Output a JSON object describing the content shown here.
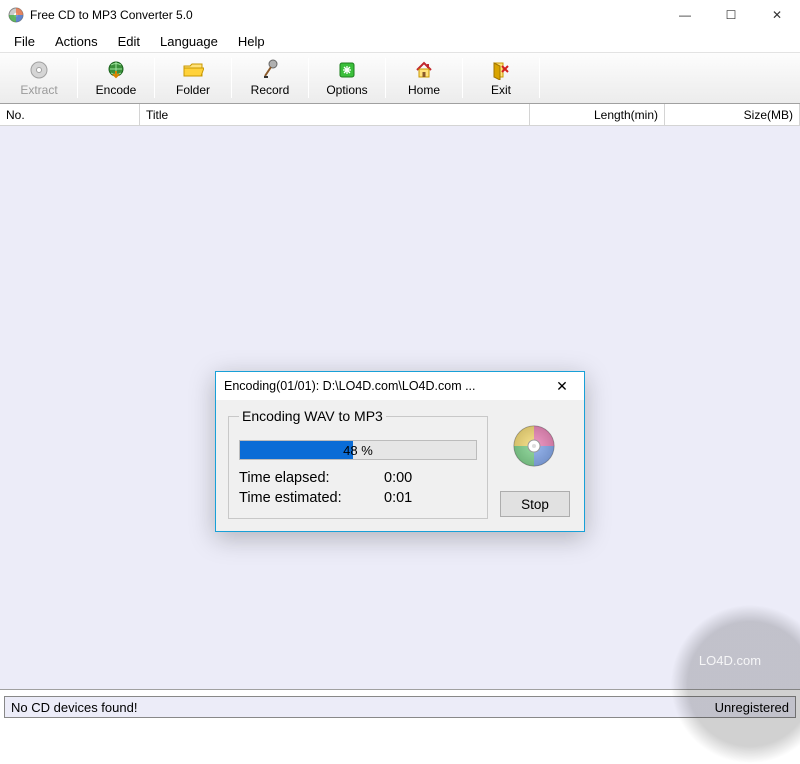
{
  "window": {
    "title": "Free CD to MP3 Converter 5.0",
    "controls": {
      "min": "—",
      "max": "☐",
      "close": "✕"
    }
  },
  "menu": {
    "file": "File",
    "actions": "Actions",
    "edit": "Edit",
    "language": "Language",
    "help": "Help"
  },
  "toolbar": {
    "extract": "Extract",
    "encode": "Encode",
    "folder": "Folder",
    "record": "Record",
    "options": "Options",
    "home": "Home",
    "exit": "Exit"
  },
  "columns": {
    "no": "No.",
    "title": "Title",
    "length": "Length(min)",
    "size": "Size(MB)"
  },
  "status": {
    "left": "No CD devices found!",
    "right": "Unregistered"
  },
  "dialog": {
    "title": "Encoding(01/01): D:\\LO4D.com\\LO4D.com ...",
    "group_label": "Encoding WAV to MP3",
    "progress_percent": 48,
    "progress_text": "48 %",
    "elapsed_label": "Time elapsed:",
    "elapsed_value": "0:00",
    "estimated_label": "Time estimated:",
    "estimated_value": "0:01",
    "stop": "Stop",
    "close": "✕"
  },
  "watermark": "LO4D.com"
}
